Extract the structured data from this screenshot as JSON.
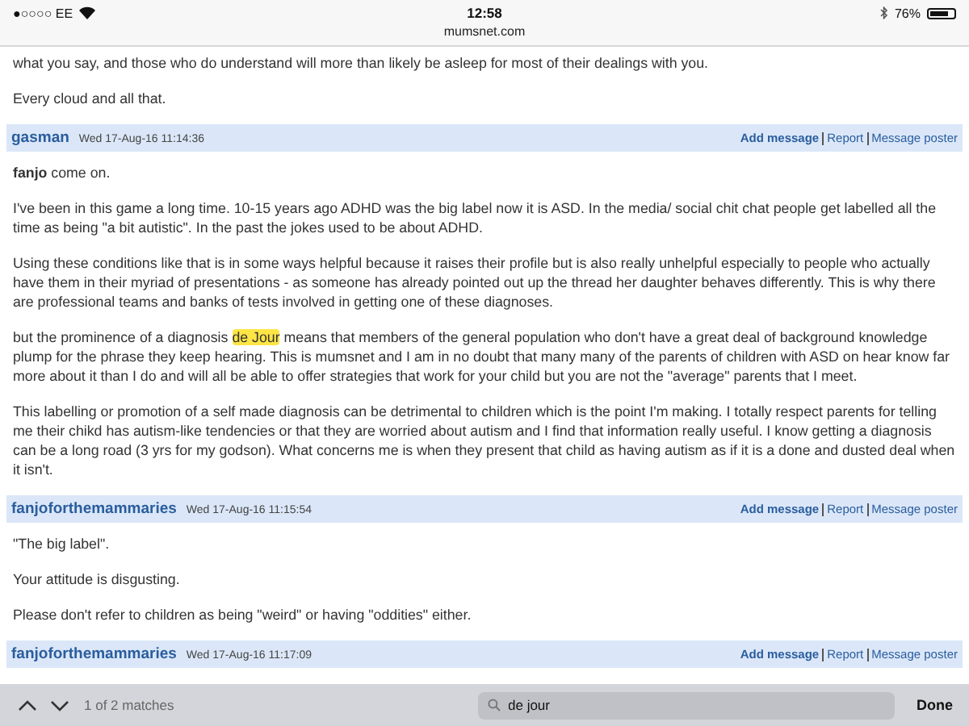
{
  "status_bar": {
    "carrier": "●○○○○ EE",
    "time": "12:58",
    "battery": "76%"
  },
  "url": "mumsnet.com",
  "intro_paragraphs": [
    [
      {
        "text": "what you say, and those who do understand will more than likely be asleep for most of their dealings with you."
      }
    ],
    [
      {
        "text": "Every cloud and all that."
      }
    ]
  ],
  "posts": [
    {
      "author": "gasman",
      "date": "Wed 17-Aug-16 11:14:36",
      "actions": [
        "Add message",
        "Report",
        "Message poster"
      ],
      "paragraphs": [
        [
          {
            "text": "**fanjo** come on."
          }
        ],
        [
          {
            "text": "I've been in this game a long time. 10-15 years ago ADHD was the big label now it is ASD. In the media/ social chit chat people get labelled all the time as being \"a bit autistic\". In the past the jokes used to be about ADHD."
          }
        ],
        [
          {
            "text": "Using these conditions like that is in some ways helpful because it raises their profile but is also really unhelpful especially to people who actually have them in their myriad of presentations - as someone has already pointed out up the thread her daughter behaves differently. This is why there are professional teams and banks of tests involved in getting one of these diagnoses."
          }
        ],
        [
          {
            "text": "but the prominence of a diagnosis ",
            "highlighted": false
          },
          {
            "text": "de Jour",
            "highlighted": true
          },
          {
            "text": " means that members of the general population who don't have a great deal of background knowledge plump for the phrase they keep hearing. This is mumsnet and I am in no doubt that many many of the parents of children with ASD on hear know far more about it than I do and will all be able to offer strategies that work for your child but you are not the \"average\" parents that I meet.",
            "highlighted": false
          }
        ],
        [
          {
            "text": "This labelling or promotion of a self made diagnosis can be detrimental to children which is the point I'm making. I totally respect parents for telling me their chikd has autism-like tendencies or that they are worried about autism and I find that information really useful. I know getting a diagnosis can be a long road (3 yrs for my godson). What concerns me is when they present that child as having autism as if it is a done and dusted deal when it isn't."
          }
        ]
      ]
    },
    {
      "author": "fanjoforthemammaries",
      "date": "Wed 17-Aug-16 11:15:54",
      "actions": [
        "Add message",
        "Report",
        "Message poster"
      ],
      "paragraphs": [
        [
          {
            "text": "\"The big label\"."
          }
        ],
        [
          {
            "text": "Your attitude is disgusting."
          }
        ],
        [
          {
            "text": "Please don't refer to children as being \"weird\" or having \"oddities\" either."
          }
        ]
      ]
    },
    {
      "author": "fanjoforthemammaries",
      "date": "Wed 17-Aug-16 11:17:09",
      "actions": [
        "Add message",
        "Report",
        "Message poster"
      ]
    }
  ],
  "find_bar": {
    "matches": "1 of 2 matches",
    "query": "de jour",
    "done": "Done"
  }
}
